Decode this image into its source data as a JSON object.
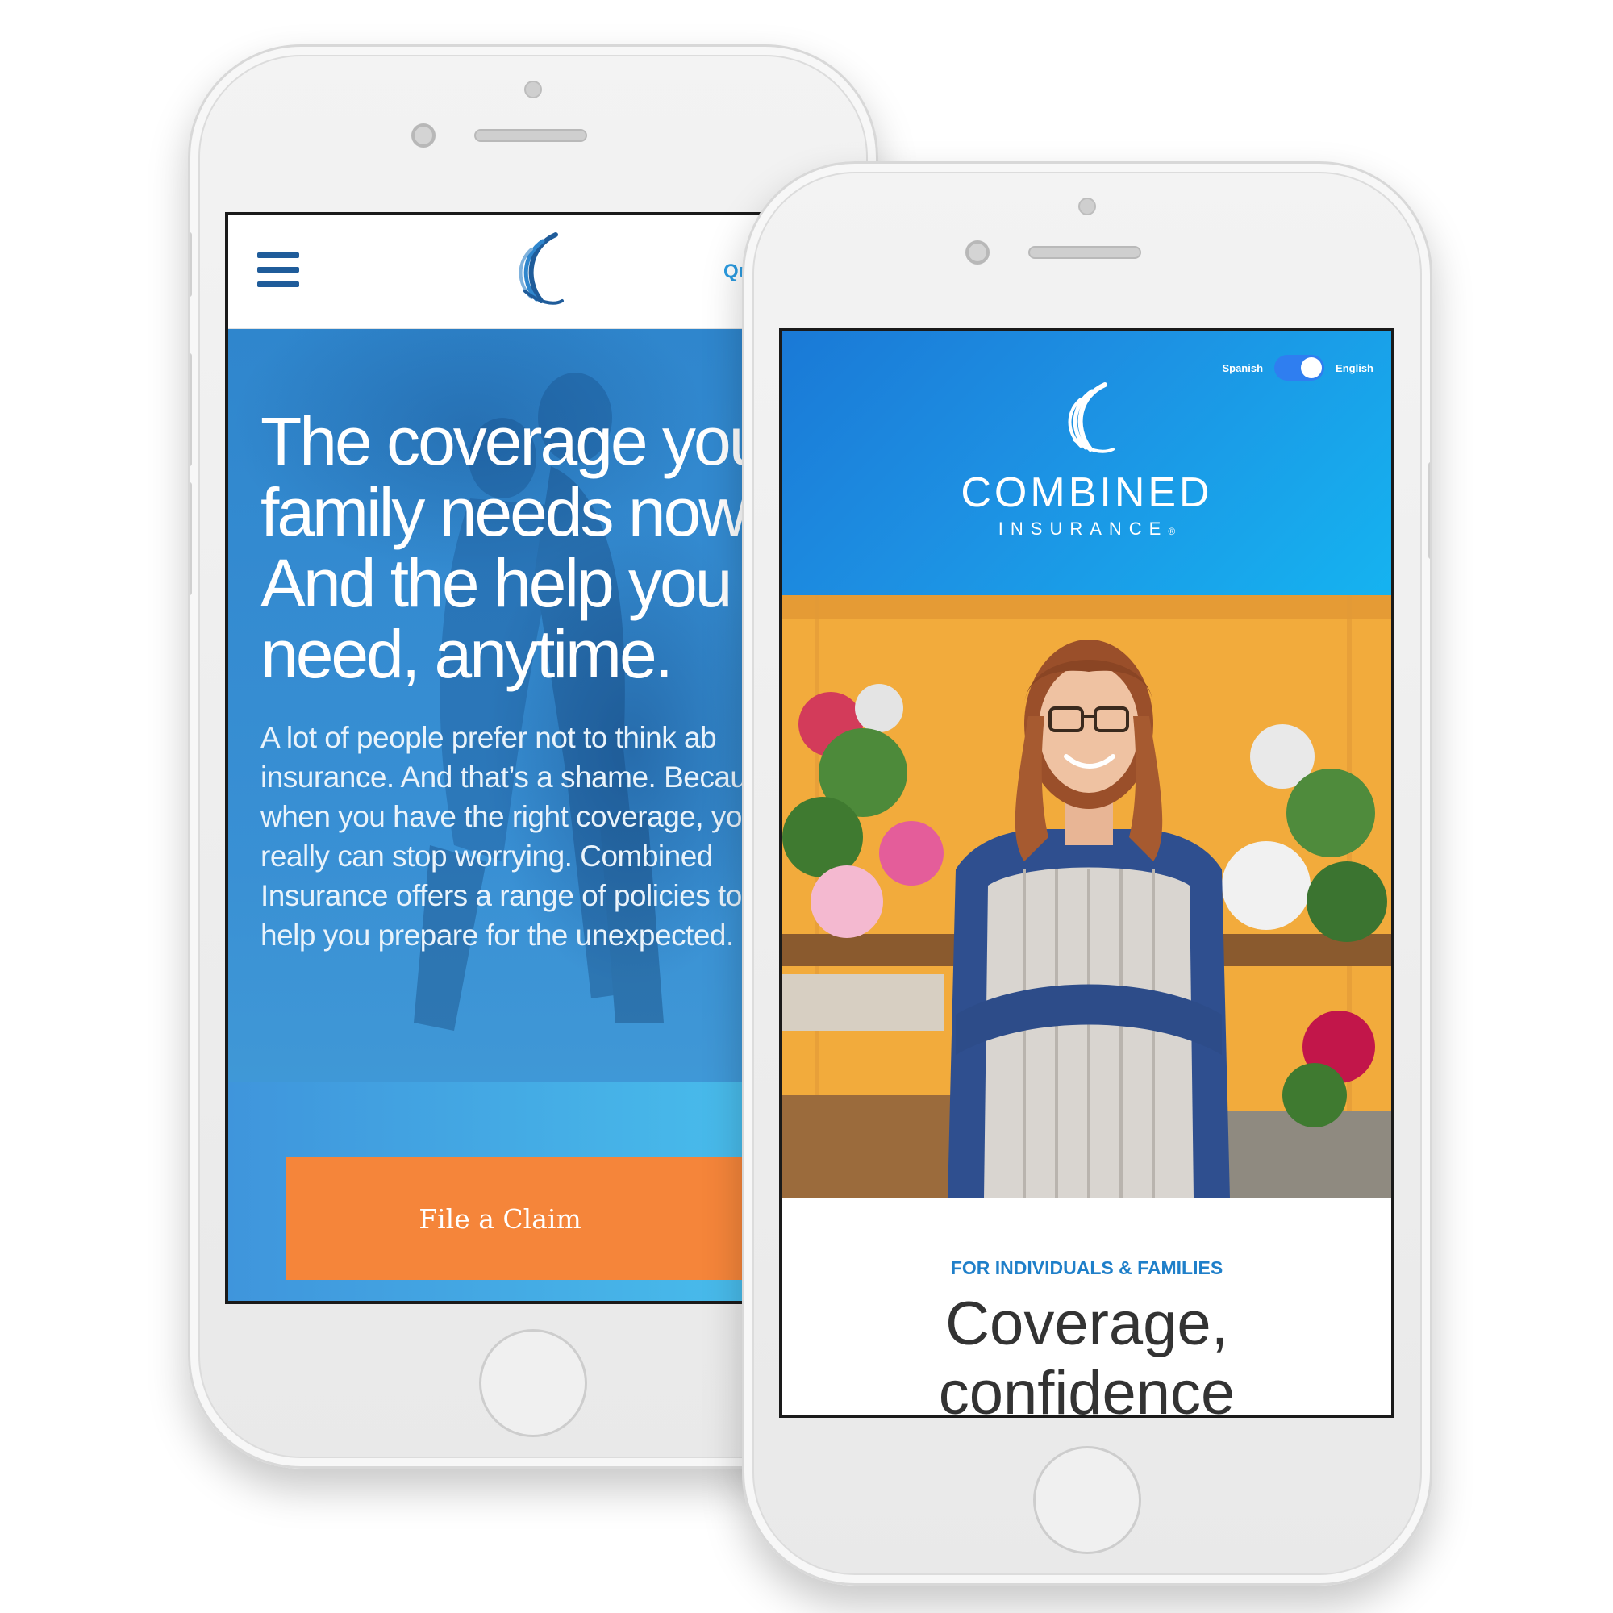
{
  "back_phone": {
    "nav": {
      "quote_link": "Qu"
    },
    "hero": {
      "headline": [
        "The coverage your",
        "family needs now.",
        "And the help you",
        "need, anytime."
      ],
      "body": [
        "A lot of people prefer not to think ab",
        "insurance. And that’s a shame. Becau",
        "when you have the right coverage, yo",
        "really can stop worrying. Combined",
        "Insurance offers a range of policies to",
        "help you prepare for the unexpected."
      ]
    },
    "cta": {
      "label": "File a Claim"
    }
  },
  "front_phone": {
    "language_toggle": {
      "left_label": "Spanish",
      "right_label": "English"
    },
    "brand": {
      "name": "COMBINED",
      "sub": "INSURANCE",
      "mark": "®"
    },
    "section": {
      "kicker": "FOR INDIVIDUALS & FAMILIES",
      "title": [
        "Coverage,",
        "confidence"
      ]
    }
  },
  "colors": {
    "primary_blue": "#1f7fc9",
    "cta_orange": "#f5853a",
    "nav_icon": "#1f5c9a",
    "link_blue": "#2b9be0"
  },
  "icons": {
    "menu": "hamburger-menu-icon",
    "logo": "combined-insurance-swoosh-logo"
  }
}
